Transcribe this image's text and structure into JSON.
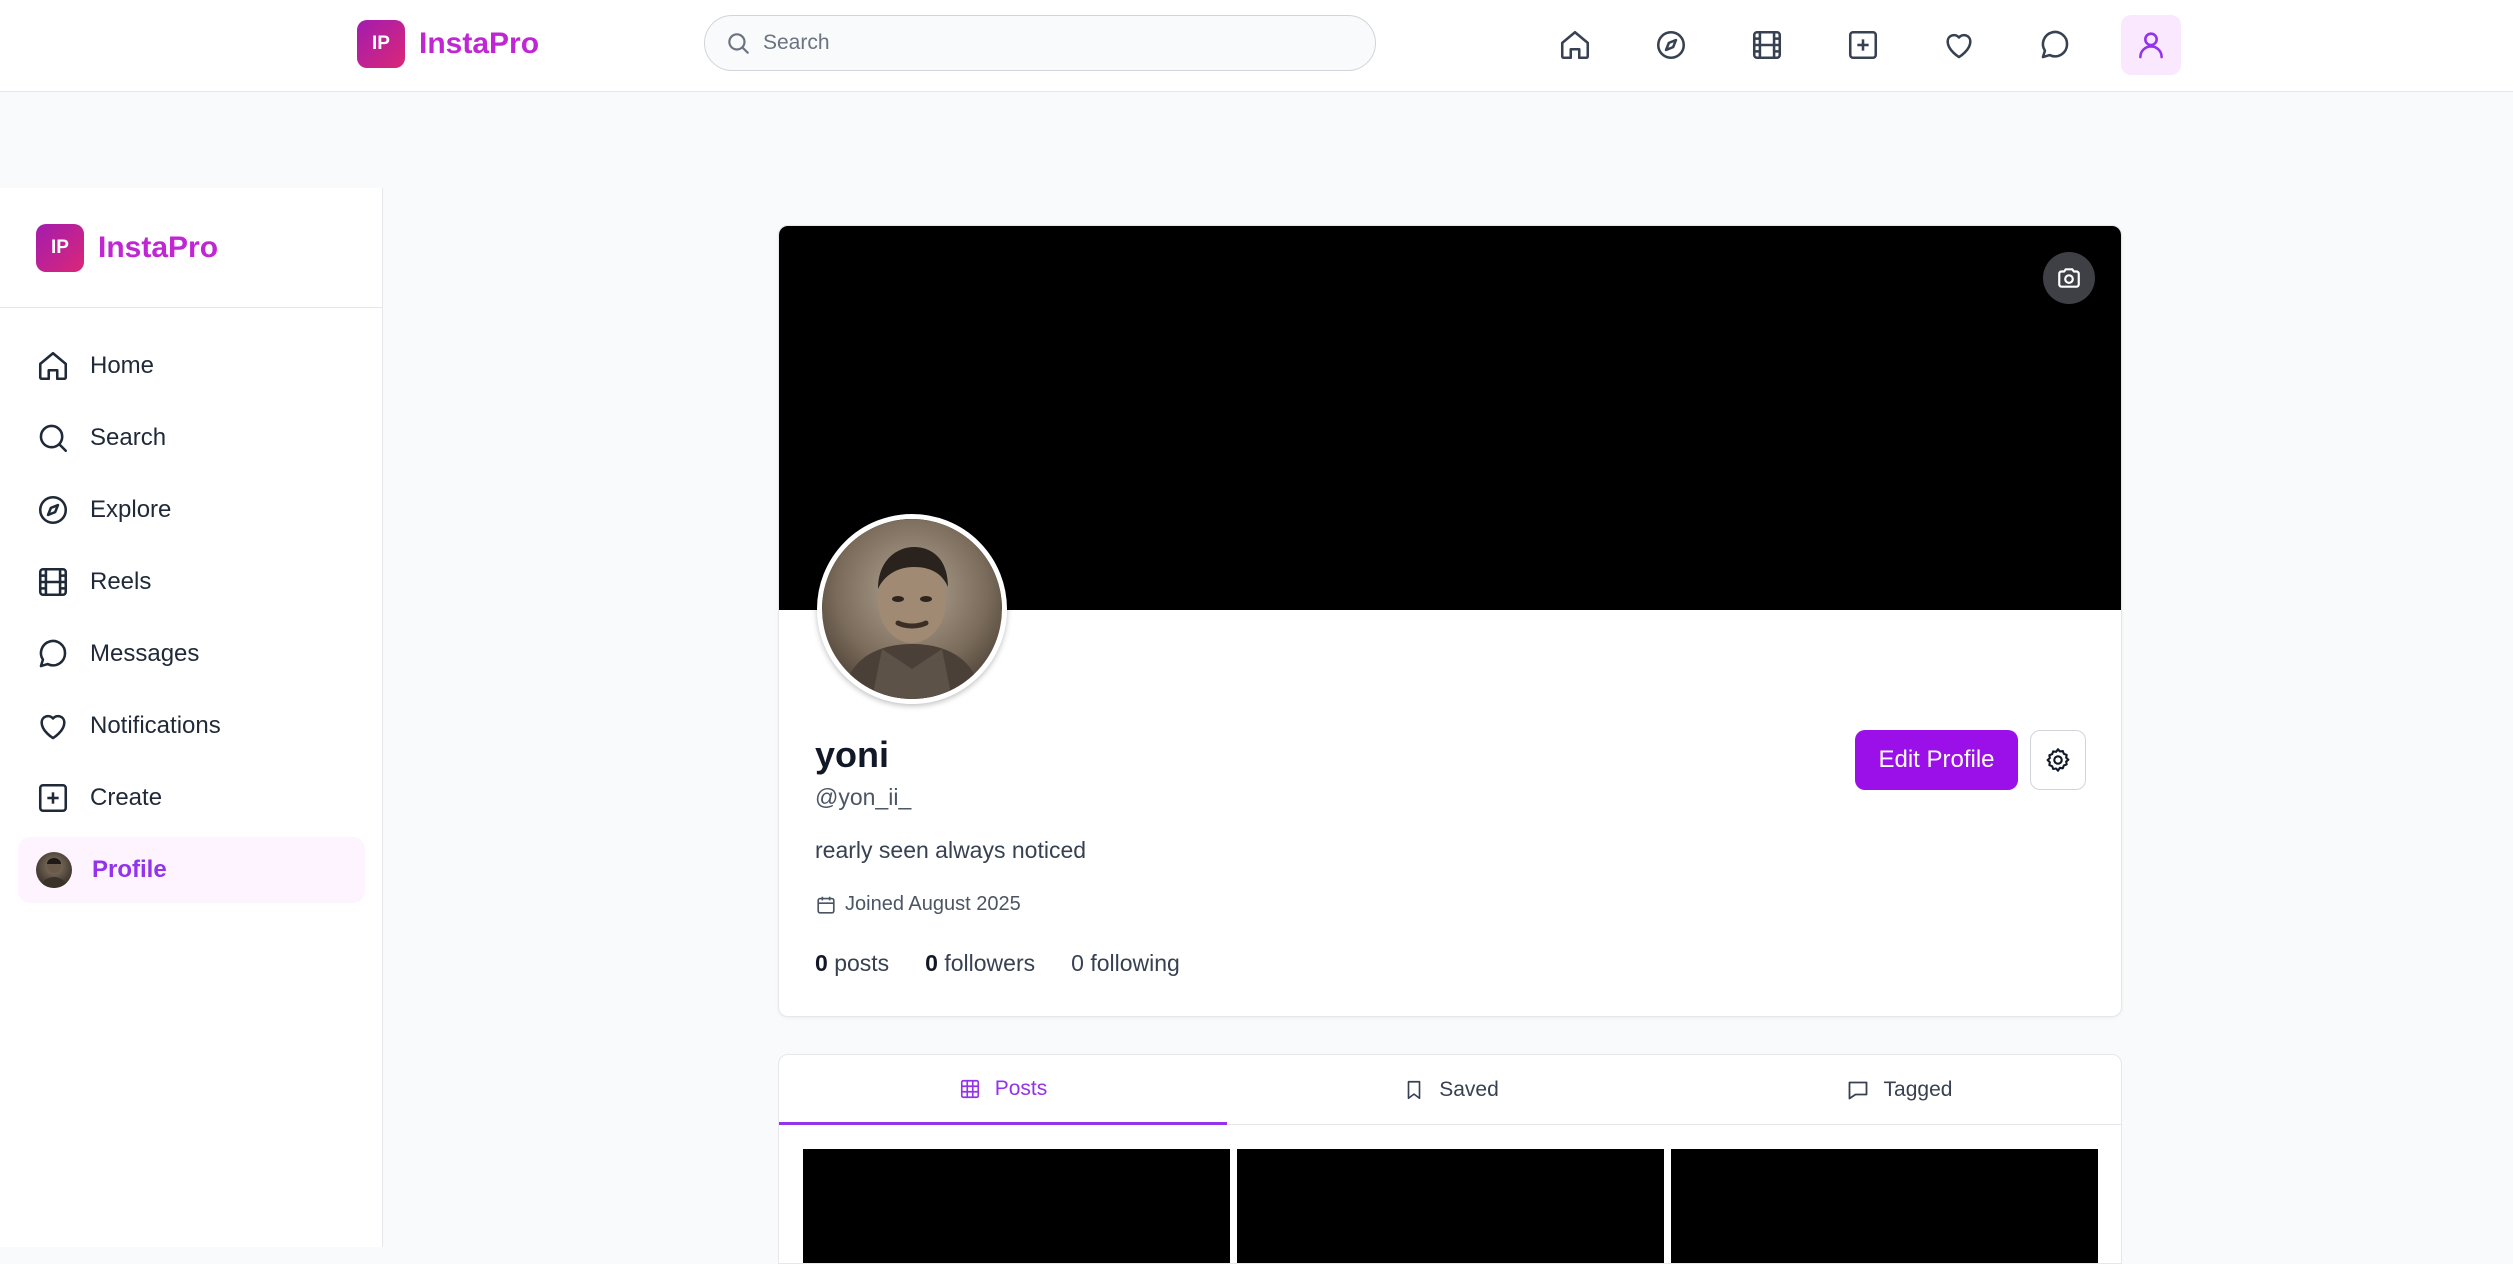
{
  "brand": {
    "mark": "IP",
    "name": "InstaPro",
    "accent": "#c026d3",
    "button": "#9b10e9"
  },
  "topbar": {
    "search_placeholder": "Search",
    "icons": [
      "home-icon",
      "compass-icon",
      "film-icon",
      "plus-square-icon",
      "heart-icon",
      "message-icon",
      "user-icon"
    ]
  },
  "sidebar": {
    "items": [
      {
        "label": "Home",
        "icon": "home-icon"
      },
      {
        "label": "Search",
        "icon": "search-icon"
      },
      {
        "label": "Explore",
        "icon": "compass-icon"
      },
      {
        "label": "Reels",
        "icon": "film-icon"
      },
      {
        "label": "Messages",
        "icon": "message-icon"
      },
      {
        "label": "Notifications",
        "icon": "heart-icon"
      },
      {
        "label": "Create",
        "icon": "plus-square-icon"
      },
      {
        "label": "Profile",
        "icon": "avatar",
        "active": true
      }
    ]
  },
  "profile": {
    "name": "yoni",
    "handle": "@yon_ii_",
    "bio": "rearly seen always noticed",
    "joined": "Joined August 2025",
    "stats": {
      "posts_count": "0",
      "posts_label": "posts",
      "followers_count": "0",
      "followers_label": "followers",
      "following_count": "0",
      "following_label": "following"
    },
    "edit_button": "Edit Profile"
  },
  "tabs": [
    {
      "label": "Posts",
      "icon": "grid-icon",
      "active": true
    },
    {
      "label": "Saved",
      "icon": "bookmark-icon"
    },
    {
      "label": "Tagged",
      "icon": "message-icon"
    }
  ]
}
